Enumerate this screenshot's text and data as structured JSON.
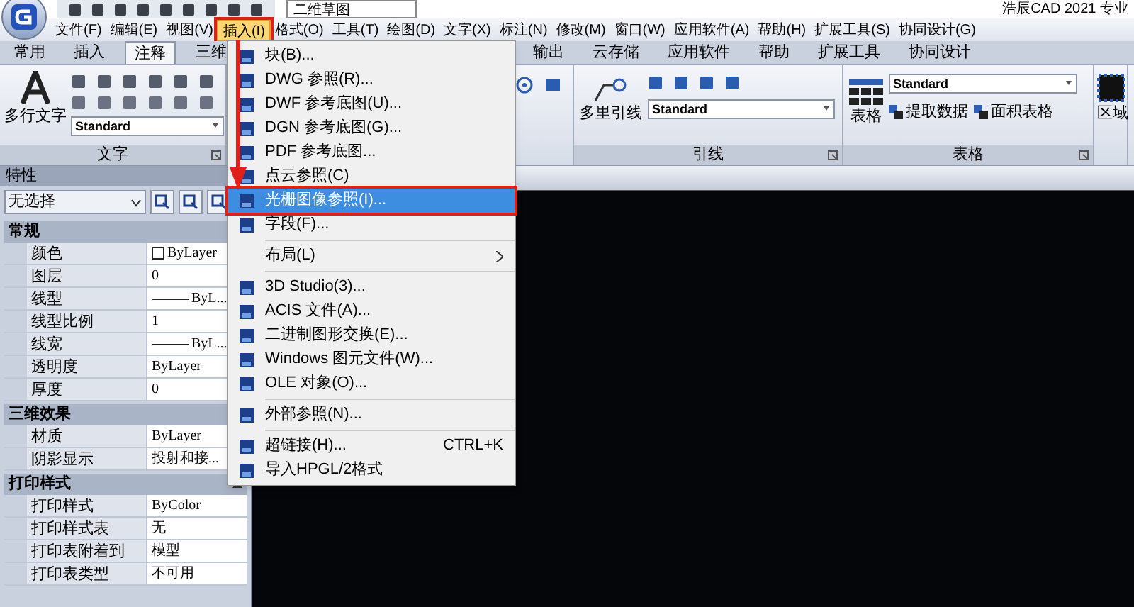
{
  "title_bar": {
    "workspace": "二维草图",
    "app_title": "浩辰CAD 2021 专业"
  },
  "menu_bar": [
    {
      "label": "文件(F)",
      "selected": false,
      "callout": false
    },
    {
      "label": "编辑(E)",
      "selected": false,
      "callout": false
    },
    {
      "label": "视图(V)",
      "selected": false,
      "callout": false
    },
    {
      "label": "插入(I)",
      "selected": true,
      "callout": true
    },
    {
      "label": "格式(O)",
      "selected": false,
      "callout": false
    },
    {
      "label": "工具(T)",
      "selected": false,
      "callout": false
    },
    {
      "label": "绘图(D)",
      "selected": false,
      "callout": false
    },
    {
      "label": "文字(X)",
      "selected": false,
      "callout": false
    },
    {
      "label": "标注(N)",
      "selected": false,
      "callout": false
    },
    {
      "label": "修改(M)",
      "selected": false,
      "callout": false
    },
    {
      "label": "窗口(W)",
      "selected": false,
      "callout": false
    },
    {
      "label": "应用软件(A)",
      "selected": false,
      "callout": false
    },
    {
      "label": "帮助(H)",
      "selected": false,
      "callout": false
    },
    {
      "label": "扩展工具(S)",
      "selected": false,
      "callout": false
    },
    {
      "label": "协同设计(G)",
      "selected": false,
      "callout": false
    }
  ],
  "ribbon_tabs": [
    {
      "label": "常用",
      "selected": false
    },
    {
      "label": "插入",
      "selected": false
    },
    {
      "label": "注释",
      "selected": true
    },
    {
      "label": "三维",
      "selected": false
    },
    {
      "label": "输出",
      "selected": false
    },
    {
      "label": "云存储",
      "selected": false
    },
    {
      "label": "应用软件",
      "selected": false
    },
    {
      "label": "帮助",
      "selected": false
    },
    {
      "label": "扩展工具",
      "selected": false
    },
    {
      "label": "协同设计",
      "selected": false
    }
  ],
  "ribbon_panels": [
    {
      "kind": "text",
      "title": "文字",
      "big_button": "多行文字",
      "style": "Standard"
    },
    {
      "kind": "leader",
      "title": "引线",
      "big_button": "多里引线",
      "style": "Standard"
    },
    {
      "kind": "table",
      "title": "表格",
      "big_button": "表格",
      "style": "Standard",
      "buttons": [
        "提取数据",
        "面积表格"
      ]
    },
    {
      "kind": "region",
      "big_button": "区域"
    }
  ],
  "insert_menu": [
    {
      "kind": "item",
      "label": "块(B)...",
      "selected": false,
      "callout": false
    },
    {
      "kind": "item",
      "label": "DWG 参照(R)...",
      "selected": false,
      "callout": false
    },
    {
      "kind": "item",
      "label": "DWF 参考底图(U)...",
      "selected": false,
      "callout": false
    },
    {
      "kind": "item",
      "label": "DGN 参考底图(G)...",
      "selected": false,
      "callout": false
    },
    {
      "kind": "item",
      "label": "PDF 参考底图...",
      "selected": false,
      "callout": false
    },
    {
      "kind": "item",
      "label": "点云参照(C)",
      "selected": false,
      "callout": false
    },
    {
      "kind": "item",
      "label": "光栅图像参照(I)...",
      "selected": true,
      "callout": true
    },
    {
      "kind": "item",
      "label": "字段(F)...",
      "selected": false,
      "callout": false
    },
    {
      "kind": "separator"
    },
    {
      "kind": "submenu",
      "label": "布局(L)",
      "selected": false,
      "callout": false
    },
    {
      "kind": "separator"
    },
    {
      "kind": "item",
      "label": "3D Studio(3)...",
      "selected": false,
      "callout": false
    },
    {
      "kind": "item",
      "label": "ACIS 文件(A)...",
      "selected": false,
      "callout": false
    },
    {
      "kind": "item",
      "label": "二进制图形交换(E)...",
      "selected": false,
      "callout": false
    },
    {
      "kind": "item",
      "label": "Windows 图元文件(W)...",
      "selected": false,
      "callout": false
    },
    {
      "kind": "item",
      "label": "OLE 对象(O)...",
      "selected": false,
      "callout": false
    },
    {
      "kind": "separator"
    },
    {
      "kind": "item",
      "label": "外部参照(N)...",
      "selected": false,
      "callout": false
    },
    {
      "kind": "separator"
    },
    {
      "kind": "item",
      "label": "超链接(H)...",
      "shortcut": "CTRL+K",
      "selected": false,
      "callout": false
    },
    {
      "kind": "item",
      "label": "导入HPGL/2格式",
      "selected": false,
      "callout": false
    }
  ],
  "properties": {
    "title": "特性",
    "selection": "无选择",
    "sections": [
      {
        "title": "常规",
        "rows": [
          {
            "name": "颜色",
            "value": "ByLayer",
            "kind": "color"
          },
          {
            "name": "图层",
            "value": "0",
            "kind": "text"
          },
          {
            "name": "线型",
            "value": "ByL...",
            "kind": "line"
          },
          {
            "name": "线型比例",
            "value": "1",
            "kind": "text"
          },
          {
            "name": "线宽",
            "value": "ByL...",
            "kind": "line"
          },
          {
            "name": "透明度",
            "value": "ByLayer",
            "kind": "text"
          },
          {
            "name": "厚度",
            "value": "0",
            "kind": "text"
          }
        ]
      },
      {
        "title": "三维效果",
        "rows": [
          {
            "name": "材质",
            "value": "ByLayer",
            "kind": "text"
          },
          {
            "name": "阴影显示",
            "value": "投射和接...",
            "kind": "text"
          }
        ]
      },
      {
        "title": "打印样式",
        "rows": [
          {
            "name": "打印样式",
            "value": "ByColor",
            "kind": "text"
          },
          {
            "name": "打印样式表",
            "value": "无",
            "kind": "text"
          },
          {
            "name": "打印表附着到",
            "value": "模型",
            "kind": "text"
          },
          {
            "name": "打印表类型",
            "value": "不可用",
            "kind": "text"
          }
        ]
      }
    ]
  }
}
